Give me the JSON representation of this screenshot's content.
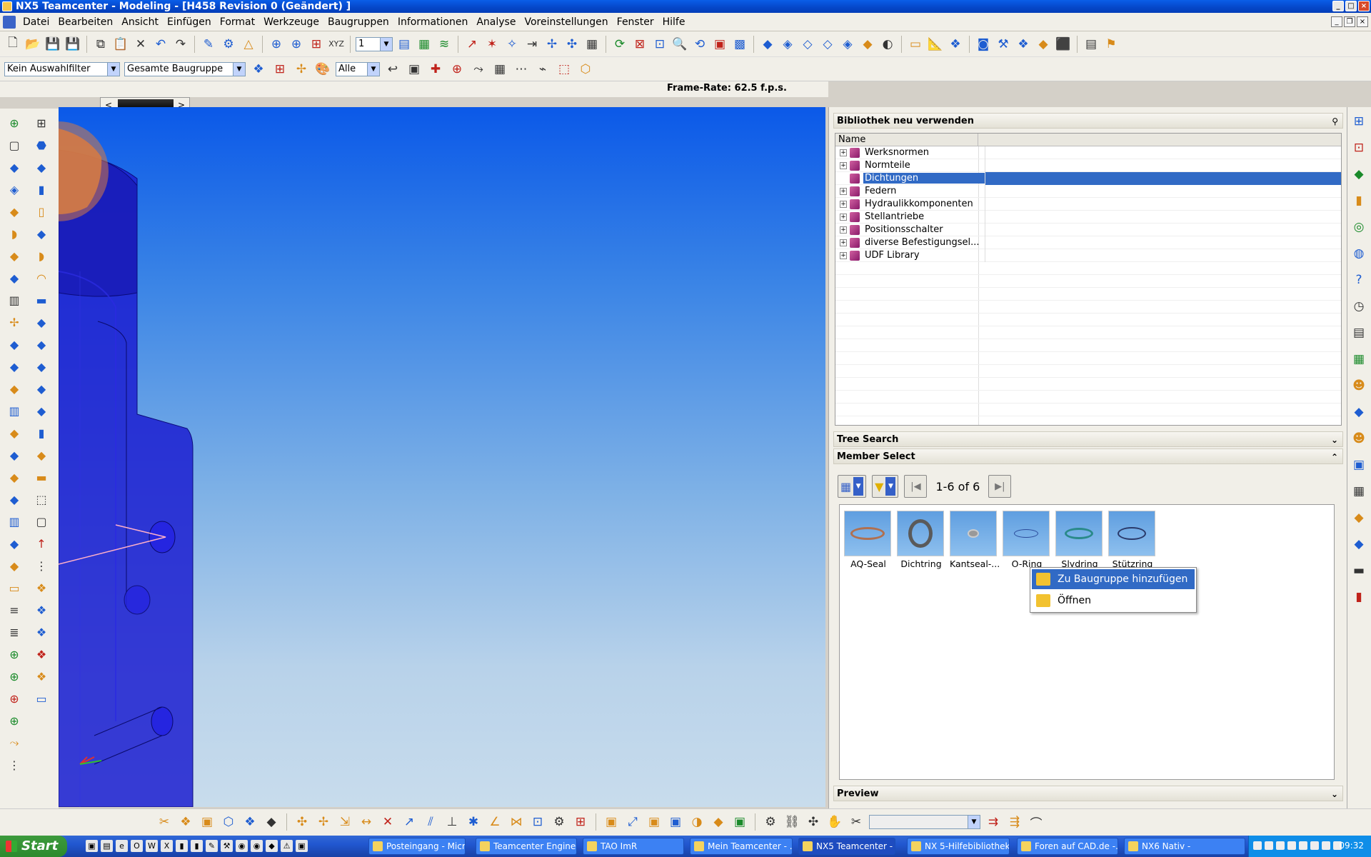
{
  "window": {
    "title": "NX5 Teamcenter - Modeling - [H458 Revision 0 (Geändert) ]"
  },
  "menubar": {
    "items": [
      "Datei",
      "Bearbeiten",
      "Ansicht",
      "Einfügen",
      "Format",
      "Werkzeuge",
      "Baugruppen",
      "Informationen",
      "Analyse",
      "Voreinstellungen",
      "Fenster",
      "Hilfe"
    ]
  },
  "toolbar1": {
    "layer_combo": "1"
  },
  "toolbar2": {
    "selection_filter": "Kein Auswahlfilter",
    "assembly_scope": "Gesamte Baugruppe",
    "type_filter": "Alle"
  },
  "status": {
    "frame_rate": "Frame-Rate: 62.5 f.p.s."
  },
  "library_panel": {
    "title": "Bibliothek neu verwenden",
    "column_name": "Name",
    "items": [
      {
        "label": "Werksnormen",
        "expandable": true
      },
      {
        "label": "Normteile",
        "expandable": true
      },
      {
        "label": "Dichtungen",
        "expandable": false,
        "selected": true
      },
      {
        "label": "Federn",
        "expandable": true
      },
      {
        "label": "Hydraulikkomponenten",
        "expandable": true
      },
      {
        "label": "Stellantriebe",
        "expandable": true
      },
      {
        "label": "Positionsschalter",
        "expandable": true
      },
      {
        "label": "diverse Befestigungsel...",
        "expandable": true
      },
      {
        "label": "UDF Library",
        "expandable": true
      }
    ],
    "tree_search": "Tree Search",
    "member_select": "Member Select",
    "member_count": "1-6 of 6",
    "members": [
      {
        "label": "AQ-Seal"
      },
      {
        "label": "Dichtring"
      },
      {
        "label": "Kantseal-..."
      },
      {
        "label": "O-Ring"
      },
      {
        "label": "Slydring"
      },
      {
        "label": "Stützring"
      }
    ],
    "preview": "Preview"
  },
  "context_menu": {
    "items": [
      "Zu Baugruppe hinzufügen",
      "Öffnen"
    ]
  },
  "taskbar": {
    "start": "Start",
    "tasks": [
      "Posteingang - Micro...",
      "Teamcenter Engine...",
      "TAO ImR",
      "Mein Teamcenter - ...",
      "NX5 Teamcenter - ...",
      "NX 5-Hilfebibliothek ...",
      "Foren auf CAD.de -...",
      "NX6 Nativ -"
    ],
    "clock": "09:32"
  },
  "colors": {
    "title_bar": "#0546c8",
    "selection": "#316ac5",
    "viewport_top": "#0b59e8",
    "viewport_bottom": "#c8dcec",
    "part_blue": "#1a20c8",
    "part_orange": "#d88040"
  }
}
